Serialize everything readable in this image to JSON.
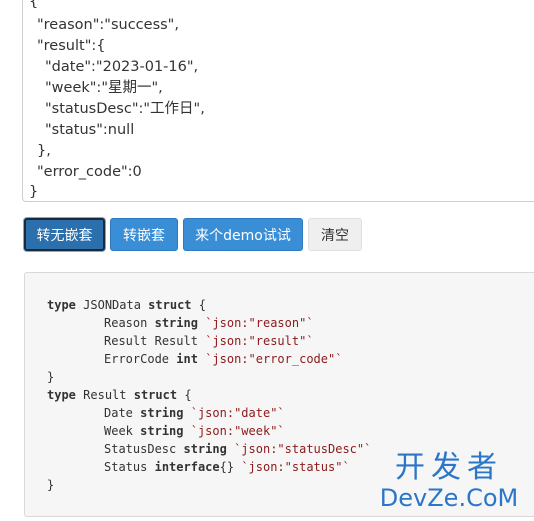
{
  "json_output": {
    "lines": [
      "{",
      "\"reason\":\"success\",",
      "\"result\":{",
      "\"date\":\"2023-01-16\",",
      "\"week\":\"星期一\",",
      "\"statusDesc\":\"工作日\",",
      "\"status\":null",
      "},",
      "\"error_code\":0",
      "}"
    ]
  },
  "toolbar": {
    "to_flat_label": "转无嵌套",
    "to_nested_label": "转嵌套",
    "demo_label": "来个demo试试",
    "clear_label": "清空"
  },
  "code": {
    "l1": {
      "kw1": "type",
      "name": "JSONData",
      "kw2": "struct",
      "brace": "{"
    },
    "l2": {
      "field": "Reason",
      "type": "string",
      "tag": "`json:\"reason\"`"
    },
    "l3": {
      "field": "Result",
      "type": "Result",
      "tag": "`json:\"result\"`"
    },
    "l4": {
      "field": "ErrorCode",
      "type": "int",
      "tag": "`json:\"error_code\"`"
    },
    "l5": {
      "brace": "}"
    },
    "l6": {
      "kw1": "type",
      "name": "Result",
      "kw2": "struct",
      "brace": "{"
    },
    "l7": {
      "field": "Date",
      "type": "string",
      "tag": "`json:\"date\"`"
    },
    "l8": {
      "field": "Week",
      "type": "string",
      "tag": "`json:\"week\"`"
    },
    "l9": {
      "field": "StatusDesc",
      "type": "string",
      "tag": "`json:\"statusDesc\"`"
    },
    "l10": {
      "field": "Status",
      "type": "interface",
      "suffix": "{}",
      "tag": "`json:\"status\"`"
    },
    "l11": {
      "brace": "}"
    }
  },
  "watermark": {
    "cn": "开发者",
    "en": "DevZe.CoM"
  }
}
